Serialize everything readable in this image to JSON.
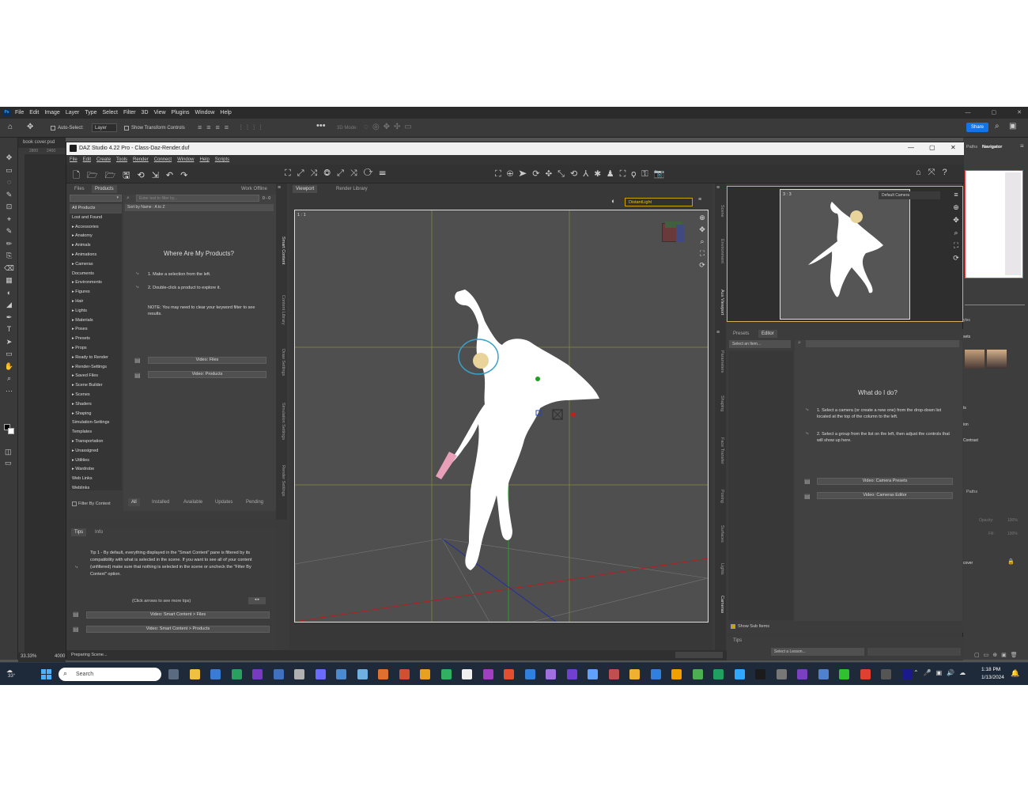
{
  "photoshop": {
    "menu": [
      "File",
      "Edit",
      "Image",
      "Layer",
      "Type",
      "Select",
      "Filter",
      "3D",
      "View",
      "Plugins",
      "Window",
      "Help"
    ],
    "options": {
      "auto_select": "Auto-Select:",
      "layer": "Layer",
      "transform": "Show Transform Controls",
      "mode3d": "3D Mode:"
    },
    "doc_tab": "book cover.psd",
    "zoom": "33.33%",
    "status_px": "4000",
    "share": "Share",
    "right_tabs": {
      "paths": "Paths",
      "navigator": "Navigator"
    },
    "panel_labels": {
      "styles": "yles",
      "sets": "sets",
      "ts": "ts",
      "ion": "ion",
      "contrast": "Contrast",
      "paths": "Paths",
      "opacity": "Opacity:",
      "opacity_val": "100%",
      "fill": "Fill:",
      "fill_val": "100%",
      "layer_name": "cover"
    },
    "ruler_top": [
      "2800",
      "2400"
    ]
  },
  "daz": {
    "title": "DAZ Studio 4.22 Pro - Class-Daz-Render.duf",
    "menu": [
      "File",
      "Edit",
      "Create",
      "Tools",
      "Render",
      "Connect",
      "Window",
      "Help",
      "Scripts"
    ],
    "content_tabs": {
      "files": "Files",
      "products": "Products",
      "work_offline": "Work Offline"
    },
    "filter_placeholder": "Enter text to filter by...",
    "count": "0 - 0",
    "sort": "Sort by Name : A to Z",
    "categories": [
      "All Products",
      "Lost and Found",
      "▸ Accessories",
      "▸ Anatomy",
      "▸ Animals",
      "▸ Animations",
      "▸ Cameras",
      "Documents",
      "▸ Environments",
      "▸ Figures",
      "▸ Hair",
      "▸ Lights",
      "▸ Materials",
      "▸ Poses",
      "▸ Presets",
      "▸ Props",
      "▸ Ready to Render",
      "▸ Render-Settings",
      "▸ Saved Files",
      "▸ Scene Builder",
      "▸ Scenes",
      "▸ Shaders",
      "▸ Shaping",
      "Simulation-Settings",
      "Templates",
      "▸ Transportation",
      "▸ Unassigned",
      "▸ Utilities",
      "▸ Wardrobe",
      "Web Links",
      "Weblinks"
    ],
    "products_help": {
      "heading": "Where Are My Products?",
      "step1": "1. Make a selection from the left.",
      "step2": "2. Double-click a product to explore it.",
      "note": "NOTE: You may need to clear your keyword filter to see results.",
      "video_files": "Video: Files",
      "video_products": "Video: Products"
    },
    "filter_context": "Filter By Context",
    "bottom_tabs": [
      "All",
      "Installed",
      "Available",
      "Updates",
      "Pending"
    ],
    "tips_tabs": {
      "tips": "Tips",
      "info": "Info"
    },
    "tip_text": "Tip 1 - By default, everything displayed in the \"Smart Content\" pane is filtered by its compatibility with what is selected in the scene. If you want to see all of your content (unfiltered) make sure that nothing is selected in the scene or uncheck the \"Filter By Context\" option.",
    "tip_nav": "(Click arrows to see more tips)",
    "video_sc_files": "Video: Smart Content > Files",
    "video_sc_products": "Video: Smart Content > Products",
    "left_vtabs": [
      "Smart Content",
      "Content Library",
      "Draw Settings",
      "Simulation Settings",
      "Render Settings"
    ],
    "viewport_tabs": {
      "viewport": "Viewport",
      "render_library": "Render Library"
    },
    "light_select": "DistantLight",
    "viewport_ratio": "1 : 1",
    "aux_ratio": "3 : 3",
    "aux_camera": "Default Camera",
    "right_vtabs": [
      "Scene",
      "Environment",
      "Aux Viewport",
      "Parameters",
      "Shaping",
      "Face Transfer",
      "Posing",
      "Surfaces",
      "Lights",
      "Cameras"
    ],
    "presets_tabs": {
      "presets": "Presets",
      "editor": "Editor"
    },
    "select_item": "Select an Item...",
    "cam_help": {
      "heading": "What do I do?",
      "step1": "1. Select a camera (or create a new one) from the drop-down list located at the top of the column to the left.",
      "step2": "2. Select a group from the list on the left, then adjust the controls that will show up here.",
      "video_presets": "Video: Camera Presets",
      "video_editor": "Video: Cameras Editor"
    },
    "show_sub": "Show Sub Items",
    "tips_right": "Tips",
    "lesson": "Select a Lesson...",
    "status": "Preparing Scene..."
  },
  "taskbar": {
    "temp": "33°",
    "search": "Search",
    "time": "1:18 PM",
    "date": "1/13/2024"
  }
}
